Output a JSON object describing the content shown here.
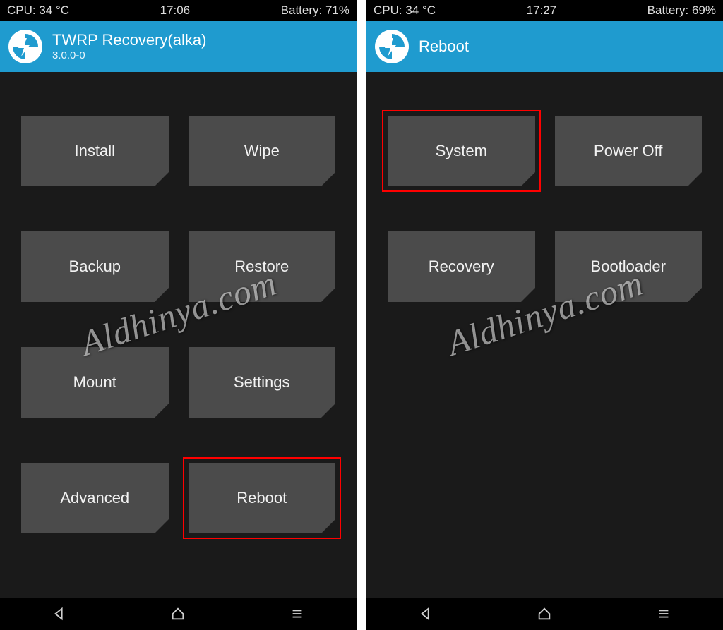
{
  "watermark": "Aldhinya.com",
  "left": {
    "status": {
      "cpu": "CPU: 34 °C",
      "time": "17:06",
      "battery": "Battery: 71%"
    },
    "header": {
      "title": "TWRP Recovery(alka)",
      "subtitle": "3.0.0-0"
    },
    "buttons": [
      {
        "label": "Install",
        "name": "install-button",
        "highlight": false
      },
      {
        "label": "Wipe",
        "name": "wipe-button",
        "highlight": false
      },
      {
        "label": "Backup",
        "name": "backup-button",
        "highlight": false
      },
      {
        "label": "Restore",
        "name": "restore-button",
        "highlight": false
      },
      {
        "label": "Mount",
        "name": "mount-button",
        "highlight": false
      },
      {
        "label": "Settings",
        "name": "settings-button",
        "highlight": false
      },
      {
        "label": "Advanced",
        "name": "advanced-button",
        "highlight": false
      },
      {
        "label": "Reboot",
        "name": "reboot-button",
        "highlight": true
      }
    ]
  },
  "right": {
    "status": {
      "cpu": "CPU: 34 °C",
      "time": "17:27",
      "battery": "Battery: 69%"
    },
    "header": {
      "title": "Reboot",
      "subtitle": ""
    },
    "buttons": [
      {
        "label": "System",
        "name": "reboot-system-button",
        "highlight": true
      },
      {
        "label": "Power Off",
        "name": "power-off-button",
        "highlight": false
      },
      {
        "label": "Recovery",
        "name": "reboot-recovery-button",
        "highlight": false
      },
      {
        "label": "Bootloader",
        "name": "reboot-bootloader-button",
        "highlight": false
      }
    ]
  }
}
